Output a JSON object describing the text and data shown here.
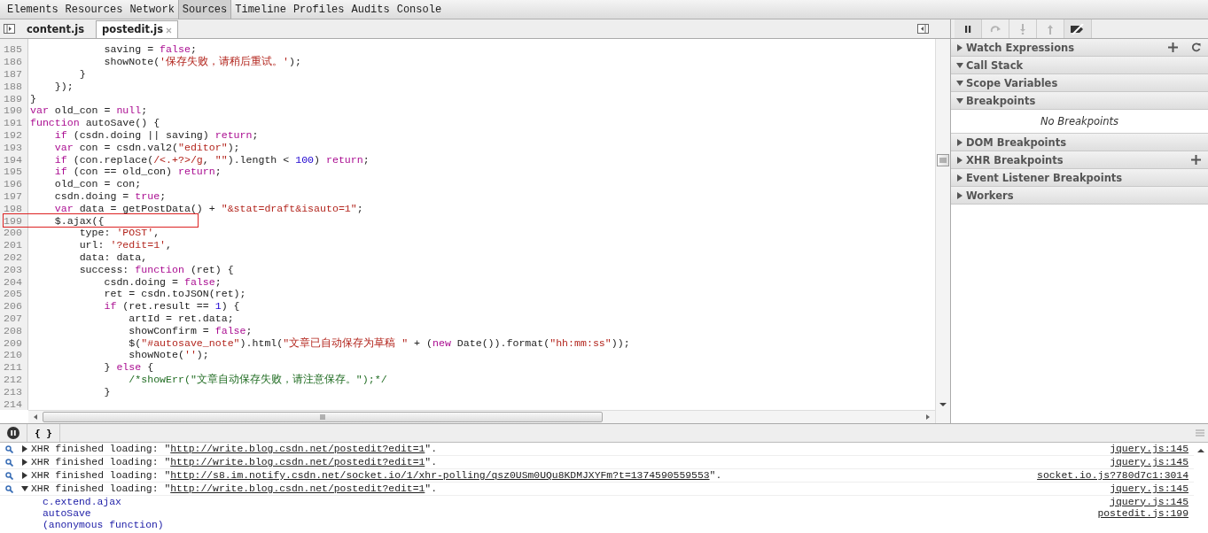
{
  "devtools_tabs": [
    {
      "label": "Elements",
      "selected": false
    },
    {
      "label": "Resources",
      "selected": false
    },
    {
      "label": "Network",
      "selected": false
    },
    {
      "label": "Sources",
      "selected": true
    },
    {
      "label": "Timeline",
      "selected": false
    },
    {
      "label": "Profiles",
      "selected": false
    },
    {
      "label": "Audits",
      "selected": false
    },
    {
      "label": "Console",
      "selected": false
    }
  ],
  "file_tabs": [
    {
      "label": "content.js",
      "selected": false,
      "closable": false
    },
    {
      "label": "postedit.js",
      "selected": true,
      "closable": true
    }
  ],
  "code_lines": [
    {
      "number": "185",
      "boxed": false,
      "tokens": [
        {
          "kind": "plain",
          "text": "            saving = "
        },
        {
          "kind": "kw",
          "text": "false"
        },
        {
          "kind": "plain",
          "text": ";"
        }
      ]
    },
    {
      "number": "186",
      "boxed": false,
      "tokens": [
        {
          "kind": "plain",
          "text": "            showNote("
        },
        {
          "kind": "str",
          "text": "'保存失败，请稍后重试。'"
        },
        {
          "kind": "plain",
          "text": ");"
        }
      ]
    },
    {
      "number": "187",
      "boxed": false,
      "tokens": [
        {
          "kind": "plain",
          "text": "        }"
        }
      ]
    },
    {
      "number": "188",
      "boxed": false,
      "tokens": [
        {
          "kind": "plain",
          "text": "    });"
        }
      ]
    },
    {
      "number": "189",
      "boxed": false,
      "tokens": [
        {
          "kind": "plain",
          "text": "}"
        }
      ]
    },
    {
      "number": "190",
      "boxed": false,
      "tokens": [
        {
          "kind": "kw",
          "text": "var"
        },
        {
          "kind": "plain",
          "text": " old_con = "
        },
        {
          "kind": "kw",
          "text": "null"
        },
        {
          "kind": "plain",
          "text": ";"
        }
      ]
    },
    {
      "number": "191",
      "boxed": false,
      "tokens": [
        {
          "kind": "kw",
          "text": "function"
        },
        {
          "kind": "plain",
          "text": " autoSave() {"
        }
      ]
    },
    {
      "number": "192",
      "boxed": false,
      "tokens": [
        {
          "kind": "kw",
          "text": "    if"
        },
        {
          "kind": "plain",
          "text": " (csdn.doing || saving) "
        },
        {
          "kind": "kw",
          "text": "return"
        },
        {
          "kind": "plain",
          "text": ";"
        }
      ]
    },
    {
      "number": "193",
      "boxed": false,
      "tokens": [
        {
          "kind": "kw",
          "text": "    var"
        },
        {
          "kind": "plain",
          "text": " con = csdn.val2("
        },
        {
          "kind": "str",
          "text": "\"editor\""
        },
        {
          "kind": "plain",
          "text": ");"
        }
      ]
    },
    {
      "number": "194",
      "boxed": false,
      "tokens": [
        {
          "kind": "kw",
          "text": "    if"
        },
        {
          "kind": "plain",
          "text": " (con.replace("
        },
        {
          "kind": "str",
          "text": "/<.+?>/g"
        },
        {
          "kind": "plain",
          "text": ", "
        },
        {
          "kind": "str",
          "text": "\"\""
        },
        {
          "kind": "plain",
          "text": ").length < "
        },
        {
          "kind": "num",
          "text": "100"
        },
        {
          "kind": "plain",
          "text": ") "
        },
        {
          "kind": "kw",
          "text": "return"
        },
        {
          "kind": "plain",
          "text": ";"
        }
      ]
    },
    {
      "number": "195",
      "boxed": false,
      "tokens": [
        {
          "kind": "kw",
          "text": "    if"
        },
        {
          "kind": "plain",
          "text": " (con == old_con) "
        },
        {
          "kind": "kw",
          "text": "return"
        },
        {
          "kind": "plain",
          "text": ";"
        }
      ]
    },
    {
      "number": "196",
      "boxed": false,
      "tokens": [
        {
          "kind": "plain",
          "text": "    old_con = con;"
        }
      ]
    },
    {
      "number": "197",
      "boxed": false,
      "tokens": [
        {
          "kind": "plain",
          "text": "    csdn.doing = "
        },
        {
          "kind": "kw",
          "text": "true"
        },
        {
          "kind": "plain",
          "text": ";"
        }
      ]
    },
    {
      "number": "198",
      "boxed": false,
      "tokens": [
        {
          "kind": "kw",
          "text": "    var"
        },
        {
          "kind": "plain",
          "text": " data = getPostData() + "
        },
        {
          "kind": "str",
          "text": "\"&stat=draft&isauto=1\""
        },
        {
          "kind": "plain",
          "text": ";"
        }
      ]
    },
    {
      "number": "199",
      "boxed": true,
      "tokens": [
        {
          "kind": "plain",
          "text": "    $.ajax({"
        }
      ]
    },
    {
      "number": "200",
      "boxed": false,
      "tokens": [
        {
          "kind": "plain",
          "text": "        type: "
        },
        {
          "kind": "str",
          "text": "'POST'"
        },
        {
          "kind": "plain",
          "text": ","
        }
      ]
    },
    {
      "number": "201",
      "boxed": false,
      "tokens": [
        {
          "kind": "plain",
          "text": "        url: "
        },
        {
          "kind": "str",
          "text": "'?edit=1'"
        },
        {
          "kind": "plain",
          "text": ","
        }
      ]
    },
    {
      "number": "202",
      "boxed": false,
      "tokens": [
        {
          "kind": "plain",
          "text": "        data: data,"
        }
      ]
    },
    {
      "number": "203",
      "boxed": false,
      "tokens": [
        {
          "kind": "plain",
          "text": "        success: "
        },
        {
          "kind": "kw",
          "text": "function"
        },
        {
          "kind": "plain",
          "text": " (ret) {"
        }
      ]
    },
    {
      "number": "204",
      "boxed": false,
      "tokens": [
        {
          "kind": "plain",
          "text": "            csdn.doing = "
        },
        {
          "kind": "kw",
          "text": "false"
        },
        {
          "kind": "plain",
          "text": ";"
        }
      ]
    },
    {
      "number": "205",
      "boxed": false,
      "tokens": [
        {
          "kind": "plain",
          "text": "            ret = csdn.toJSON(ret);"
        }
      ]
    },
    {
      "number": "206",
      "boxed": false,
      "tokens": [
        {
          "kind": "kw",
          "text": "            if"
        },
        {
          "kind": "plain",
          "text": " (ret.result == "
        },
        {
          "kind": "num",
          "text": "1"
        },
        {
          "kind": "plain",
          "text": ") {"
        }
      ]
    },
    {
      "number": "207",
      "boxed": false,
      "tokens": [
        {
          "kind": "plain",
          "text": "                artId = ret.data;"
        }
      ]
    },
    {
      "number": "208",
      "boxed": false,
      "tokens": [
        {
          "kind": "plain",
          "text": "                showConfirm = "
        },
        {
          "kind": "kw",
          "text": "false"
        },
        {
          "kind": "plain",
          "text": ";"
        }
      ]
    },
    {
      "number": "209",
      "boxed": false,
      "tokens": [
        {
          "kind": "plain",
          "text": "                $("
        },
        {
          "kind": "str",
          "text": "\"#autosave_note\""
        },
        {
          "kind": "plain",
          "text": ").html("
        },
        {
          "kind": "str",
          "text": "\"文章已自动保存为草稿 \""
        },
        {
          "kind": "plain",
          "text": " + ("
        },
        {
          "kind": "kw",
          "text": "new"
        },
        {
          "kind": "plain",
          "text": " Date()).format("
        },
        {
          "kind": "str",
          "text": "\"hh:mm:ss\""
        },
        {
          "kind": "plain",
          "text": "));"
        }
      ]
    },
    {
      "number": "210",
      "boxed": false,
      "tokens": [
        {
          "kind": "plain",
          "text": "                showNote("
        },
        {
          "kind": "str",
          "text": "''"
        },
        {
          "kind": "plain",
          "text": ");"
        }
      ]
    },
    {
      "number": "211",
      "boxed": false,
      "tokens": [
        {
          "kind": "plain",
          "text": "            } "
        },
        {
          "kind": "kw",
          "text": "else"
        },
        {
          "kind": "plain",
          "text": " {"
        }
      ]
    },
    {
      "number": "212",
      "boxed": false,
      "tokens": [
        {
          "kind": "cm",
          "text": "                /*showErr(\"文章自动保存失败，请注意保存。\");*/"
        }
      ]
    },
    {
      "number": "213",
      "boxed": false,
      "tokens": [
        {
          "kind": "plain",
          "text": "            }"
        }
      ]
    },
    {
      "number": "214",
      "boxed": false
    }
  ],
  "debugger_buttons": [
    {
      "kind": "pause",
      "disabled": false
    },
    {
      "kind": "step-over",
      "disabled": true
    },
    {
      "kind": "step-into",
      "disabled": true
    },
    {
      "kind": "step-out",
      "disabled": true
    },
    {
      "kind": "deactivate",
      "disabled": false
    }
  ],
  "sidebar_sections": [
    {
      "label": "Watch Expressions",
      "expanded": false,
      "actions": [
        {
          "kind": "add"
        },
        {
          "kind": "refresh"
        }
      ]
    },
    {
      "label": "Call Stack",
      "expanded": true
    },
    {
      "label": "Scope Variables",
      "expanded": true
    },
    {
      "label": "Breakpoints",
      "expanded": true,
      "empty_text": "No Breakpoints"
    },
    {
      "label": "DOM Breakpoints",
      "expanded": false
    },
    {
      "label": "XHR Breakpoints",
      "expanded": false,
      "actions": [
        {
          "kind": "add"
        }
      ]
    },
    {
      "label": "Event Listener Breakpoints",
      "expanded": false
    },
    {
      "label": "Workers",
      "expanded": false
    }
  ],
  "console": {
    "pretty_print_label": "{ }",
    "messages": [
      {
        "expanded": false,
        "text": "XHR finished loading: \"",
        "url": "http://write.blog.csdn.net/postedit?edit=1",
        "end": "\".",
        "source": "jquery.js:145"
      },
      {
        "expanded": false,
        "text": "XHR finished loading: \"",
        "url": "http://write.blog.csdn.net/postedit?edit=1",
        "end": "\".",
        "source": "jquery.js:145"
      },
      {
        "expanded": false,
        "text": "XHR finished loading: \"",
        "url": "http://s8.im.notify.csdn.net/socket.io/1/xhr-polling/qsz0USm0UQu8KDMJXYFm?t=1374590559553",
        "end": "\".",
        "source": "socket.io.js?780d7c1:3014"
      },
      {
        "expanded": true,
        "text": "XHR finished loading: \"",
        "url": "http://write.blog.csdn.net/postedit?edit=1",
        "end": "\".",
        "source": "jquery.js:145",
        "stack": [
          {
            "name": "c.extend.ajax",
            "source": "jquery.js:145"
          },
          {
            "name": "autoSave",
            "source": "postedit.js:199"
          },
          {
            "name": "(anonymous function)"
          }
        ]
      }
    ]
  }
}
